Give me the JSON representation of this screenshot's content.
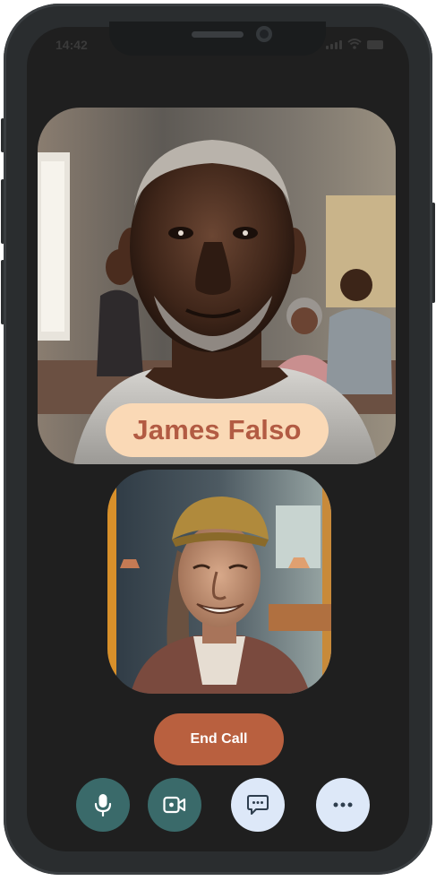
{
  "status_bar": {
    "time": "14:42"
  },
  "call": {
    "remote_name": "James Falso",
    "end_call_label": "End Call"
  },
  "controls": [
    {
      "name": "microphone",
      "icon": "microphone-icon"
    },
    {
      "name": "video",
      "icon": "video-camera-icon"
    },
    {
      "name": "chat",
      "icon": "chat-bubble-icon"
    },
    {
      "name": "more",
      "icon": "more-dots-icon"
    }
  ],
  "colors": {
    "frame": "#2a2d2f",
    "screen": "#1f1f1f",
    "name_pill_bg": "#fad9b6",
    "name_pill_text": "#b25b43",
    "end_call": "#b9603f",
    "control_dark": "#3a6a6a",
    "control_light": "#dde8f8"
  }
}
